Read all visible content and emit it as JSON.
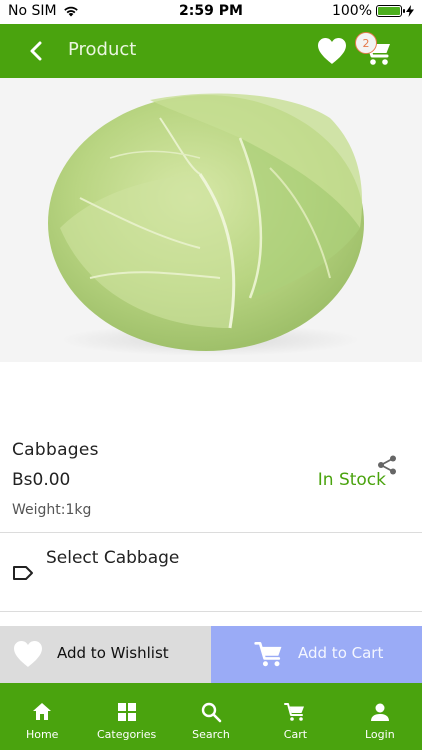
{
  "status_bar": {
    "carrier": "No SIM",
    "time": "2:59 PM",
    "battery": "100%",
    "battery_level": 1.0
  },
  "nav": {
    "title": "Product",
    "cart_count": "2",
    "icons": [
      "back-arrow-icon",
      "heart-icon",
      "cart-icon"
    ]
  },
  "product": {
    "image": "cabbage-photo",
    "name": "Cabbages",
    "price": "Bs0.00",
    "stock": "In Stock",
    "weight": "Weight:1kg",
    "variant_label": "Select Cabbage"
  },
  "actions": {
    "wishlist_label": "Add to Wishlist",
    "cart_label": "Add to Cart"
  },
  "tabs": [
    {
      "label": "Home",
      "icon": "home-icon"
    },
    {
      "label": "Categories",
      "icon": "grid-icon"
    },
    {
      "label": "Search",
      "icon": "search-icon"
    },
    {
      "label": "Cart",
      "icon": "cart-icon"
    },
    {
      "label": "Login",
      "icon": "person-icon"
    }
  ],
  "colors": {
    "brand_green": "#4aa30e",
    "stock_green": "#4aa30e",
    "wishlist_bg": "#dcdcdc",
    "cart_button_bg": "#9aabf6",
    "badge_accent": "#e57a4c"
  }
}
